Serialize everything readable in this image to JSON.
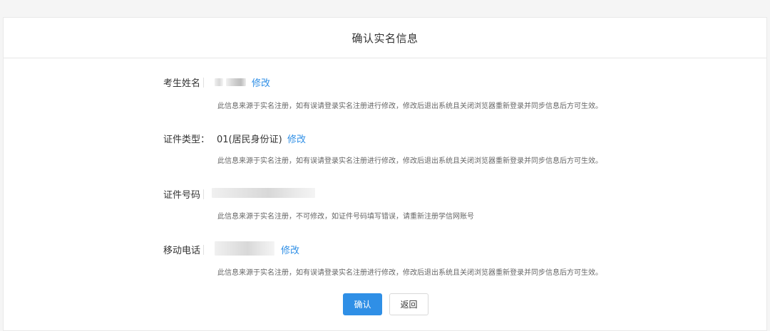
{
  "dialog": {
    "title": "确认实名信息"
  },
  "fields": [
    {
      "label": "考生姓名",
      "value": "",
      "edit_label": "修改",
      "note": "此信息来源于实名注册，如有误请登录实名注册进行修改，修改后退出系统且关闭浏览器重新登录并同步信息后方可生效。"
    },
    {
      "label": "证件类型：",
      "value": "01(居民身份证)",
      "edit_label": "修改",
      "note": "此信息来源于实名注册，如有误请登录实名注册进行修改，修改后退出系统且关闭浏览器重新登录并同步信息后方可生效。"
    },
    {
      "label": "证件号码",
      "value": "",
      "note": "此信息来源于实名注册，不可修改，如证件号码填写错误，请重新注册学信网账号"
    },
    {
      "label": "移动电话",
      "value": "",
      "edit_label": "修改",
      "note": "此信息来源于实名注册，如有误请登录实名注册进行修改，修改后退出系统且关闭浏览器重新登录并同步信息后方可生效。"
    }
  ],
  "actions": {
    "confirm_label": "确认",
    "back_label": "返回"
  },
  "colors": {
    "accent": "#2f8fe6",
    "background": "#f5f5f5",
    "panel": "#ffffff"
  }
}
